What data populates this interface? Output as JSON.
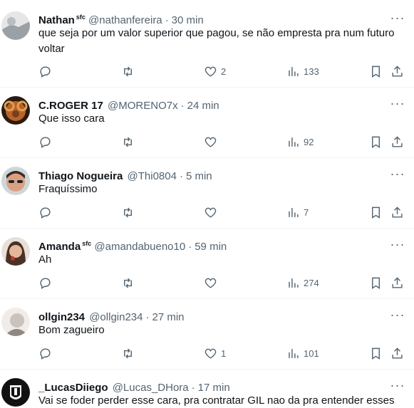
{
  "replies": [
    {
      "name": "Nathan",
      "badge": "sfc",
      "handle": "@nathanfereira",
      "sep": "·",
      "time": "30 min",
      "text": "que seja por um valor superior que pagou, se não empresta pra num futuro voltar",
      "likes": "2",
      "views": "133",
      "avatar_color": "#9aa1a6"
    },
    {
      "name": "C.ROGER 17",
      "badge": "",
      "handle": "@MORENO7x",
      "sep": "·",
      "time": "24 min",
      "text": "Que isso cara",
      "likes": "",
      "views": "92",
      "avatar_color": "#b8632a"
    },
    {
      "name": "Thiago Nogueira",
      "badge": "",
      "handle": "@Thi0804",
      "sep": "·",
      "time": "5 min",
      "text": "Fraquíssimo",
      "likes": "",
      "views": "7",
      "avatar_color": "#d9a184"
    },
    {
      "name": "Amanda",
      "badge": "sfc",
      "handle": "@amandabueno10",
      "sep": "·",
      "time": "59 min",
      "text": "Ah",
      "likes": "",
      "views": "274",
      "avatar_color": "#6b4a3a"
    },
    {
      "name": "ollgin234",
      "badge": "",
      "handle": "@ollgin234",
      "sep": "·",
      "time": "27 min",
      "text": "Bom zagueiro",
      "likes": "1",
      "views": "101",
      "avatar_color": "#c9c2bd"
    },
    {
      "name": "_LucasDiiego",
      "badge": "",
      "handle": "@Lucas_DHora",
      "sep": "·",
      "time": "17 min",
      "text": "Vai se foder perder esse cara, pra contratar GIL nao da pra entender esses",
      "likes": "",
      "views": "",
      "avatar_color": "#222222"
    }
  ],
  "icons": {
    "more": "more-icon",
    "reply": "reply-icon",
    "retweet": "retweet-icon",
    "like": "heart-icon",
    "views": "views-icon",
    "bookmark": "bookmark-icon",
    "share": "share-icon"
  },
  "colors": {
    "text": "#0f1419",
    "secondary": "#536471",
    "divider": "#eff3f4"
  }
}
